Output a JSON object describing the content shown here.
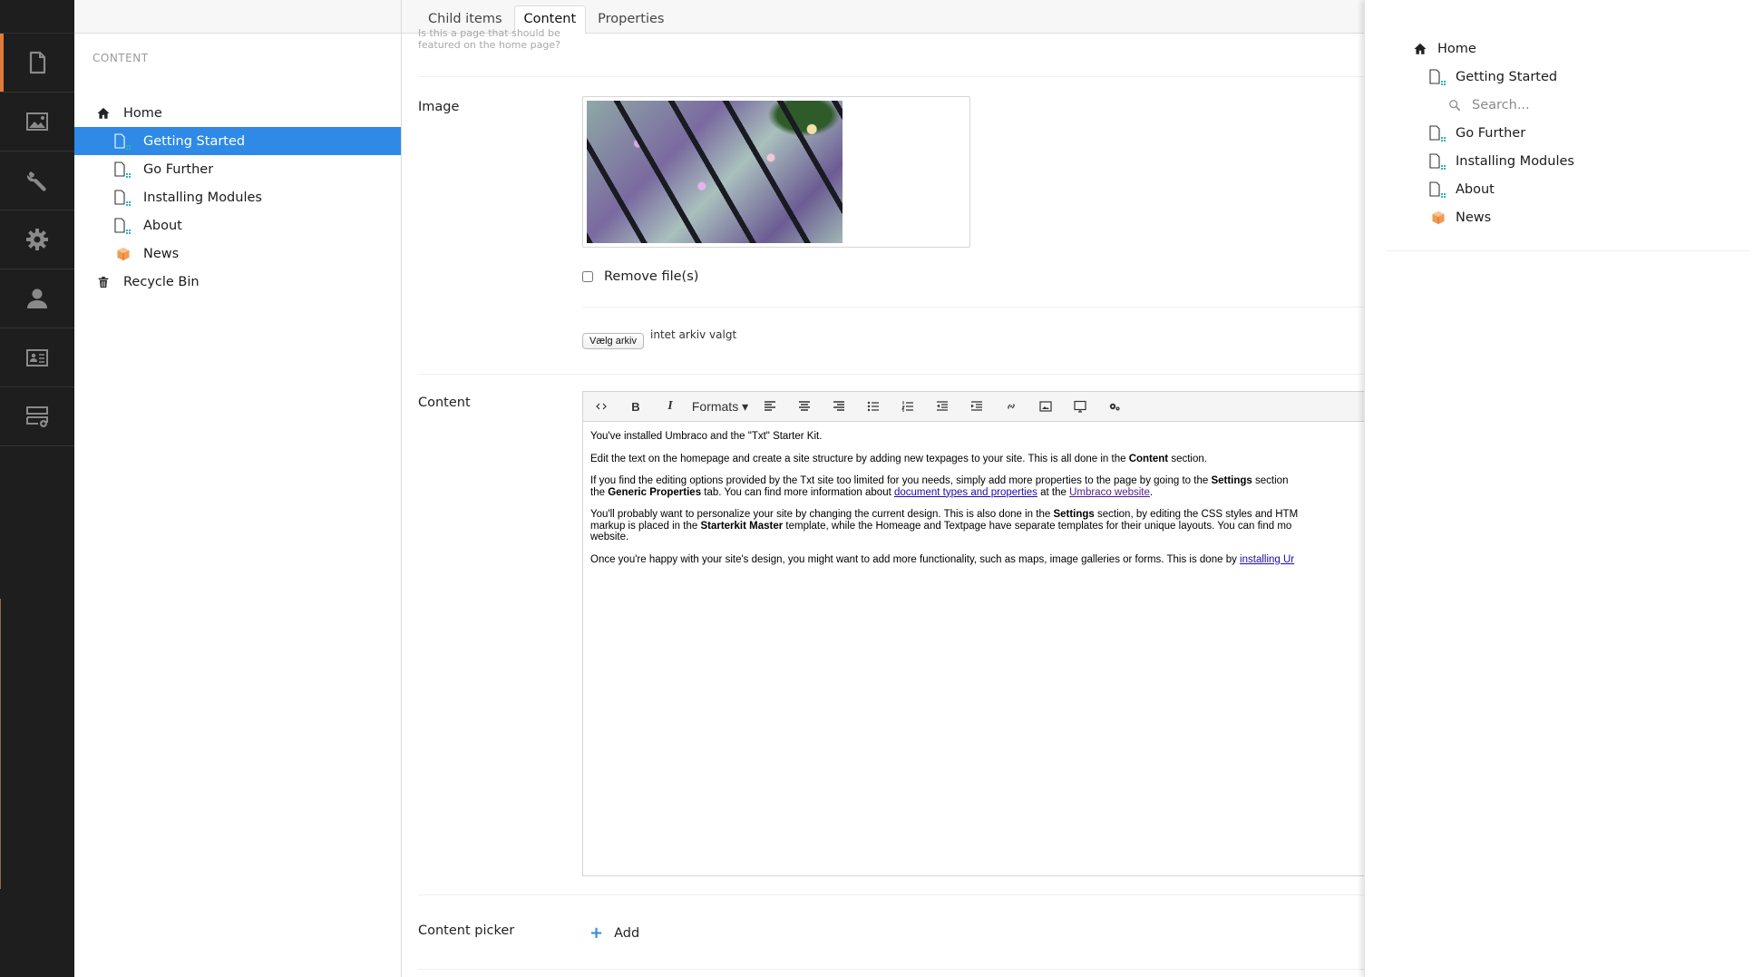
{
  "app_sections": [
    {
      "name": "content",
      "icon": "document-icon",
      "active": true
    },
    {
      "name": "media",
      "icon": "image-icon",
      "active": false
    },
    {
      "name": "developer",
      "icon": "wrench-icon",
      "active": false
    },
    {
      "name": "settings",
      "icon": "gear-icon",
      "active": false
    },
    {
      "name": "users",
      "icon": "user-icon",
      "active": false
    },
    {
      "name": "members",
      "icon": "id-card-icon",
      "active": false
    },
    {
      "name": "forms",
      "icon": "add-form-icon",
      "active": false
    }
  ],
  "tree": {
    "title": "CONTENT",
    "items": [
      {
        "label": "Home",
        "icon": "home-icon",
        "level": 0
      },
      {
        "label": "Getting Started",
        "icon": "document-icon",
        "level": 1,
        "selected": true
      },
      {
        "label": "Go Further",
        "icon": "document-icon",
        "level": 1
      },
      {
        "label": "Installing Modules",
        "icon": "document-icon",
        "level": 1
      },
      {
        "label": "About",
        "icon": "document-icon",
        "level": 1
      },
      {
        "label": "News",
        "icon": "box-icon",
        "level": 1
      },
      {
        "label": "Recycle Bin",
        "icon": "trash-icon",
        "level": 0
      }
    ]
  },
  "tabs": [
    {
      "label": "Child items",
      "active": false
    },
    {
      "label": "Content",
      "active": true
    },
    {
      "label": "Properties",
      "active": false
    }
  ],
  "editor": {
    "featured_hint": "Is this a page that should be featured on the home page?",
    "image": {
      "label": "Image",
      "remove_files_label": "Remove file(s)",
      "choose_file_button": "Vælg arkiv",
      "no_file_text": "intet arkiv valgt"
    },
    "content": {
      "label": "Content",
      "toolbar": {
        "source": "<>",
        "bold": "B",
        "italic": "I",
        "formats": "Formats ▾"
      },
      "paragraphs": {
        "p1": "You've installed Umbraco and the \"Txt\" Starter Kit.",
        "p2_a": "Edit the text on the homepage and create a site structure by adding new texpages to your site. This is all done in the ",
        "p2_b": "Content",
        "p2_c": " section.",
        "p3_a": "If you find the editing options provided by the Txt site too limited for you needs, simply add more properties to the page by going to the ",
        "p3_b": "Settings",
        "p3_c": " section",
        "p3_d": "the ",
        "p3_e": "Generic Properties",
        "p3_f": " tab. You can find more information about ",
        "p3_link1": "document types and properties",
        "p3_g": " at the ",
        "p3_link2": "Umbraco website",
        "p3_h": ".",
        "p4_a": "You'll probably want to personalize your site by changing the current design. This is also done in the ",
        "p4_b": "Settings",
        "p4_c": " section, by editing the CSS styles and HTM",
        "p4_d": "markup is placed in the ",
        "p4_e": "Starterkit Master",
        "p4_f": " template, while the Homeage and Textpage have separate templates for their unique layouts. You can find mo",
        "p4_g": "website.",
        "p5_a": "Once you're happy with your site's design, you might want to add more functionality, such as maps, image galleries or forms. This is done by ",
        "p5_link": "installing Ur"
      }
    },
    "content_picker": {
      "label": "Content picker",
      "add_label": "Add"
    }
  },
  "picker": {
    "items": [
      {
        "label": "Home",
        "icon": "home-icon"
      },
      {
        "label": "Getting Started",
        "icon": "document-icon"
      },
      {
        "label": "Search...",
        "icon": "search-icon"
      },
      {
        "label": "Go Further",
        "icon": "document-icon"
      },
      {
        "label": "Installing Modules",
        "icon": "document-icon"
      },
      {
        "label": "About",
        "icon": "document-icon"
      },
      {
        "label": "News",
        "icon": "box-icon"
      }
    ]
  },
  "colors": {
    "accent": "#2e8ae6",
    "section_active": "#e07b39",
    "appbar_bg": "#1e1e1e"
  }
}
